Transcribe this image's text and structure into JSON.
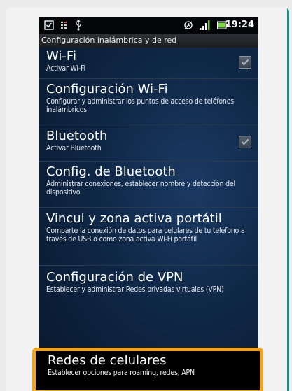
{
  "status_bar": {
    "time": "19:24",
    "icons": [
      "checkbox-icon",
      "bars-icon",
      "usb-icon",
      "alarm-icon",
      "signal-icon",
      "battery-icon"
    ]
  },
  "screen_title": "Configuración inalámbrica y de red",
  "items": [
    {
      "title": "Wi-Fi",
      "subtitle": "Activar Wi-Fi",
      "checked": true
    },
    {
      "title": "Configuración Wi-Fi",
      "subtitle": "Configurar y administrar los puntos de acceso de teléfonos inalámbricos"
    },
    {
      "title": "Bluetooth",
      "subtitle": "Activar Bluetooth",
      "checked": true
    },
    {
      "title": "Config. de Bluetooth",
      "subtitle": "Administrar conexiones, establecer nombre y detección del dispositivo"
    },
    {
      "title": "Vincul y zona activa portátil",
      "subtitle": "Comparte la conexión de datos para celulares de tu teléfono a través de USB o como zona activa Wi-Fi portátil"
    },
    {
      "title": "Configuración de VPN",
      "subtitle": "Establecer y administrar Redes privadas virtuales (VPN)"
    },
    {
      "title": "Redes de celulares",
      "subtitle": "Establecer opciones para roaming, redes, APN",
      "highlighted": true
    }
  ],
  "colors": {
    "highlight_border": "#f0a31c",
    "frame_accent": "#1f8a8a"
  }
}
